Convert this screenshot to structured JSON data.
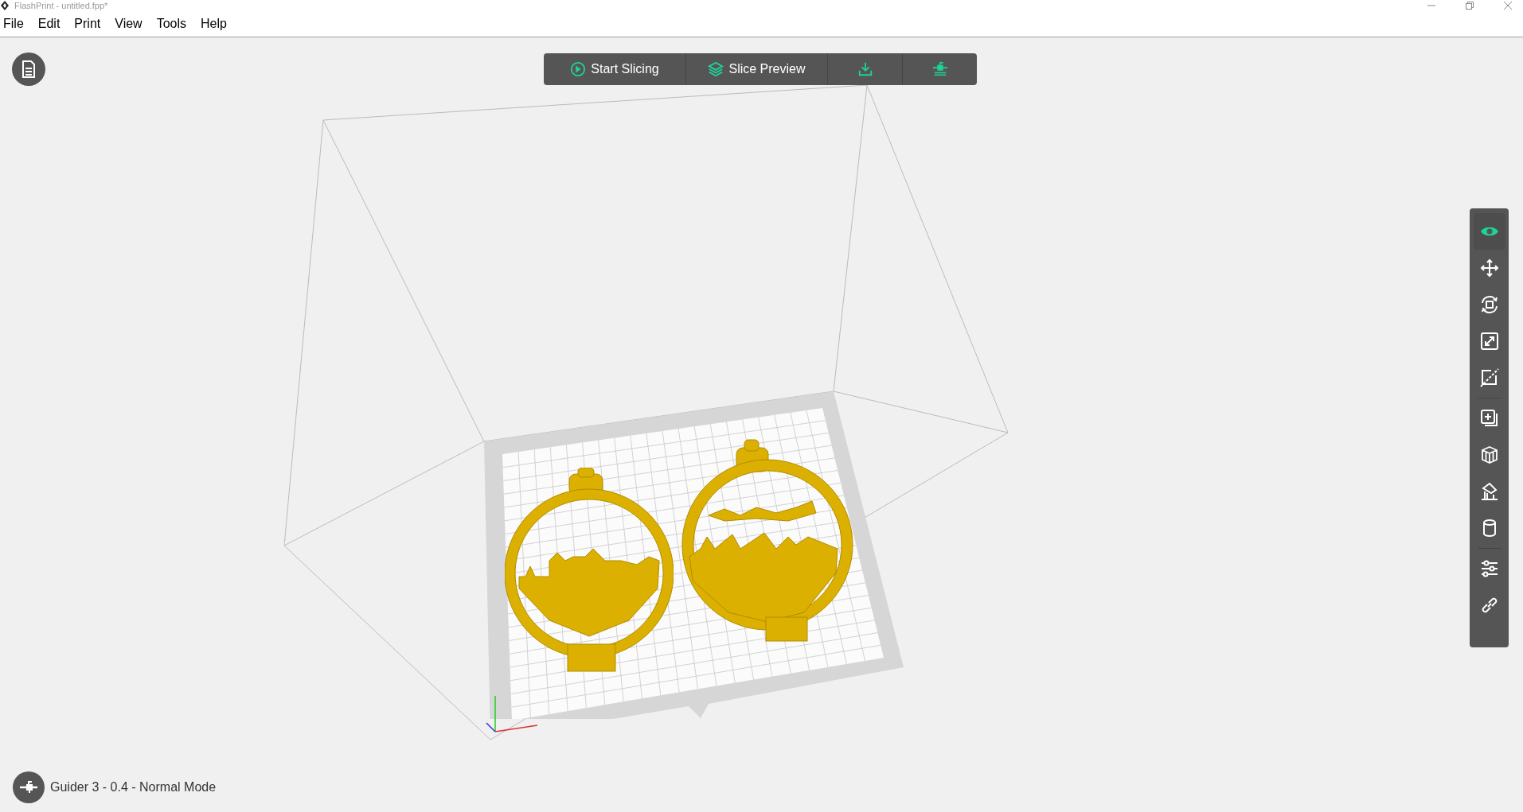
{
  "window": {
    "title": "FlashPrint - untitled.fpp*"
  },
  "menu": [
    "File",
    "Edit",
    "Print",
    "View",
    "Tools",
    "Help"
  ],
  "toolbar": [
    {
      "kind": "slice",
      "label": "Start Slicing"
    },
    {
      "kind": "preview",
      "label": "Slice Preview"
    },
    {
      "kind": "export"
    },
    {
      "kind": "printer"
    }
  ],
  "tool_groups": [
    [
      {
        "kind": "view",
        "selected": true
      },
      {
        "kind": "move",
        "selected": false
      },
      {
        "kind": "rotate",
        "selected": false
      },
      {
        "kind": "scale",
        "selected": false
      },
      {
        "kind": "cut",
        "selected": false
      }
    ],
    [
      {
        "kind": "add",
        "selected": false
      },
      {
        "kind": "extrude",
        "selected": false
      },
      {
        "kind": "supports",
        "selected": false
      },
      {
        "kind": "cylinder",
        "selected": false
      }
    ],
    [
      {
        "kind": "settings",
        "selected": false
      },
      {
        "kind": "link",
        "selected": false
      }
    ]
  ],
  "status": {
    "machine": "Guider 3 - 0.4 - Normal Mode"
  }
}
